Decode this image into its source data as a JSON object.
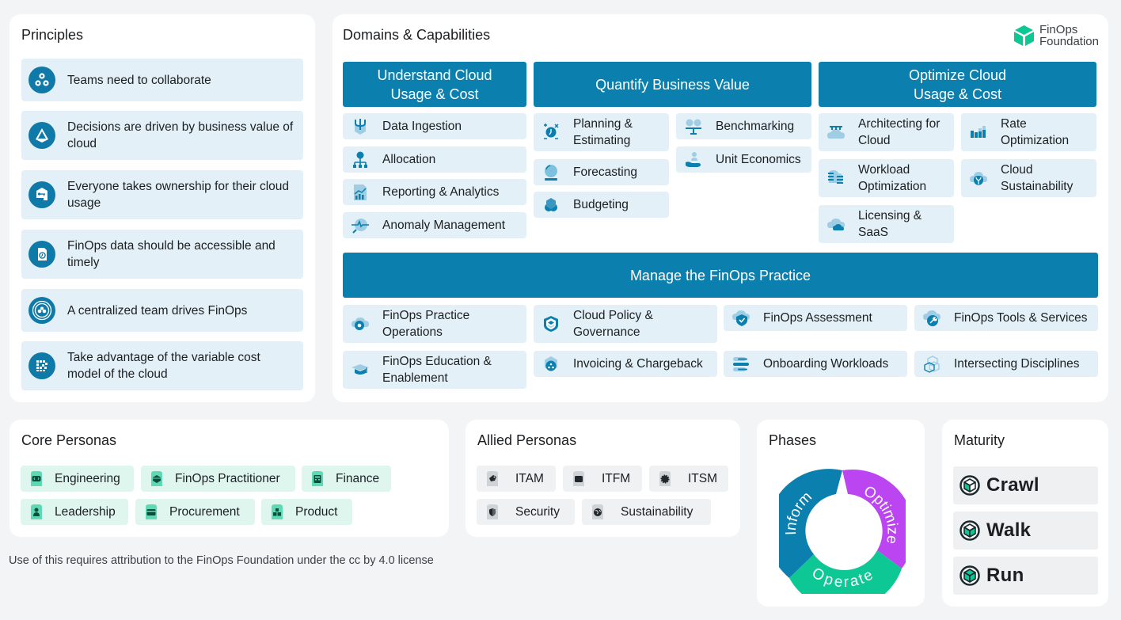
{
  "principles": {
    "title": "Principles",
    "items": [
      {
        "label": "Teams need to collaborate",
        "icon": "gears-icon"
      },
      {
        "label": "Decisions are driven by business value of cloud",
        "icon": "pyramid-icon"
      },
      {
        "label": "Everyone takes ownership for their cloud usage",
        "icon": "key-icon"
      },
      {
        "label": "FinOps data should be accessible and timely",
        "icon": "document-clock-icon"
      },
      {
        "label": "A centralized team drives FinOps",
        "icon": "team-circle-icon"
      },
      {
        "label": "Take advantage of the variable cost model of the cloud",
        "icon": "grid-dots-icon"
      }
    ]
  },
  "domains": {
    "title": "Domains & Capabilities",
    "logo": {
      "line1": "FinOps",
      "line2": "Foundation"
    },
    "headers": {
      "understand": "Understand Cloud Usage & Cost",
      "quantify": "Quantify Business Value",
      "optimize": "Optimize Cloud Usage & Cost",
      "manage": "Manage the FinOps Practice"
    },
    "understand": [
      {
        "label": "Data Ingestion",
        "icon": "trident-shield-icon"
      },
      {
        "label": "Allocation",
        "icon": "hierarchy-icon"
      },
      {
        "label": "Reporting & Analytics",
        "icon": "chart-report-icon"
      },
      {
        "label": "Anomaly Management",
        "icon": "magnifier-pulse-icon"
      }
    ],
    "quantify": [
      {
        "label": "Planning & Estimating",
        "icon": "planning-clock-icon"
      },
      {
        "label": "Forecasting",
        "icon": "crystal-ball-icon"
      },
      {
        "label": "Budgeting",
        "icon": "budget-hexagon-icon"
      },
      {
        "label": "Benchmarking",
        "icon": "scale-icon"
      },
      {
        "label": "Unit Economics",
        "icon": "hand-person-icon"
      }
    ],
    "optimize": [
      {
        "label": "Architecting for Cloud",
        "icon": "cloud-architecture-icon"
      },
      {
        "label": "Workload Optimization",
        "icon": "stacked-workload-icon"
      },
      {
        "label": "Licensing & SaaS",
        "icon": "cloud-license-icon"
      },
      {
        "label": "Rate Optimization",
        "icon": "bar-chart-icon"
      },
      {
        "label": "Cloud Sustainability",
        "icon": "cloud-leaf-icon"
      }
    ],
    "manage": [
      {
        "label": "FinOps Practice Operations",
        "icon": "cloud-gear-icon"
      },
      {
        "label": "Cloud Policy & Governance",
        "icon": "shield-layers-icon"
      },
      {
        "label": "FinOps Assessment",
        "icon": "shield-check-icon"
      },
      {
        "label": "FinOps Tools & Services",
        "icon": "cloud-wrench-icon"
      },
      {
        "label": "FinOps Education & Enablement",
        "icon": "graduation-cap-icon"
      },
      {
        "label": "Invoicing & Chargeback",
        "icon": "invoice-hexagon-icon"
      },
      {
        "label": "Onboarding Workloads",
        "icon": "onboarding-bars-icon"
      },
      {
        "label": "Intersecting Disciplines",
        "icon": "cubes-icon"
      }
    ]
  },
  "core_personas": {
    "title": "Core Personas",
    "items": [
      {
        "label": "Engineering",
        "icon": "code-shirt-icon"
      },
      {
        "label": "FinOps Practitioner",
        "icon": "hexagon-shirt-icon"
      },
      {
        "label": "Finance",
        "icon": "calculator-shirt-icon"
      },
      {
        "label": "Leadership",
        "icon": "people-shirt-icon"
      },
      {
        "label": "Procurement",
        "icon": "card-shirt-icon"
      },
      {
        "label": "Product",
        "icon": "boxes-shirt-icon"
      }
    ]
  },
  "allied_personas": {
    "title": "Allied Personas",
    "items": [
      {
        "label": "ITAM",
        "icon": "tag-shirt-icon"
      },
      {
        "label": "ITFM",
        "icon": "wallet-shirt-icon"
      },
      {
        "label": "ITSM",
        "icon": "gear-shirt-icon"
      },
      {
        "label": "Security",
        "icon": "shield-shirt-icon"
      },
      {
        "label": "Sustainability",
        "icon": "globe-shirt-icon"
      }
    ]
  },
  "phases": {
    "title": "Phases",
    "items": [
      {
        "label": "Inform",
        "color": "#0b7fae"
      },
      {
        "label": "Optimize",
        "color": "#bb45f0"
      },
      {
        "label": "Operate",
        "color": "#0dc794"
      }
    ]
  },
  "maturity": {
    "title": "Maturity",
    "items": [
      {
        "label": "Crawl",
        "filled_faces": 1
      },
      {
        "label": "Walk",
        "filled_faces": 2
      },
      {
        "label": "Run",
        "filled_faces": 3
      }
    ]
  },
  "colors": {
    "domain_header": "#0b7fae",
    "capability_bg": "#e3f0f7",
    "core_persona_bg": "#dff6ef",
    "allied_persona_bg": "#eff1f3",
    "logo_green": "#0dc794"
  },
  "footer": "Use of this requires attribution to the FinOps Foundation under the cc by 4.0 license"
}
